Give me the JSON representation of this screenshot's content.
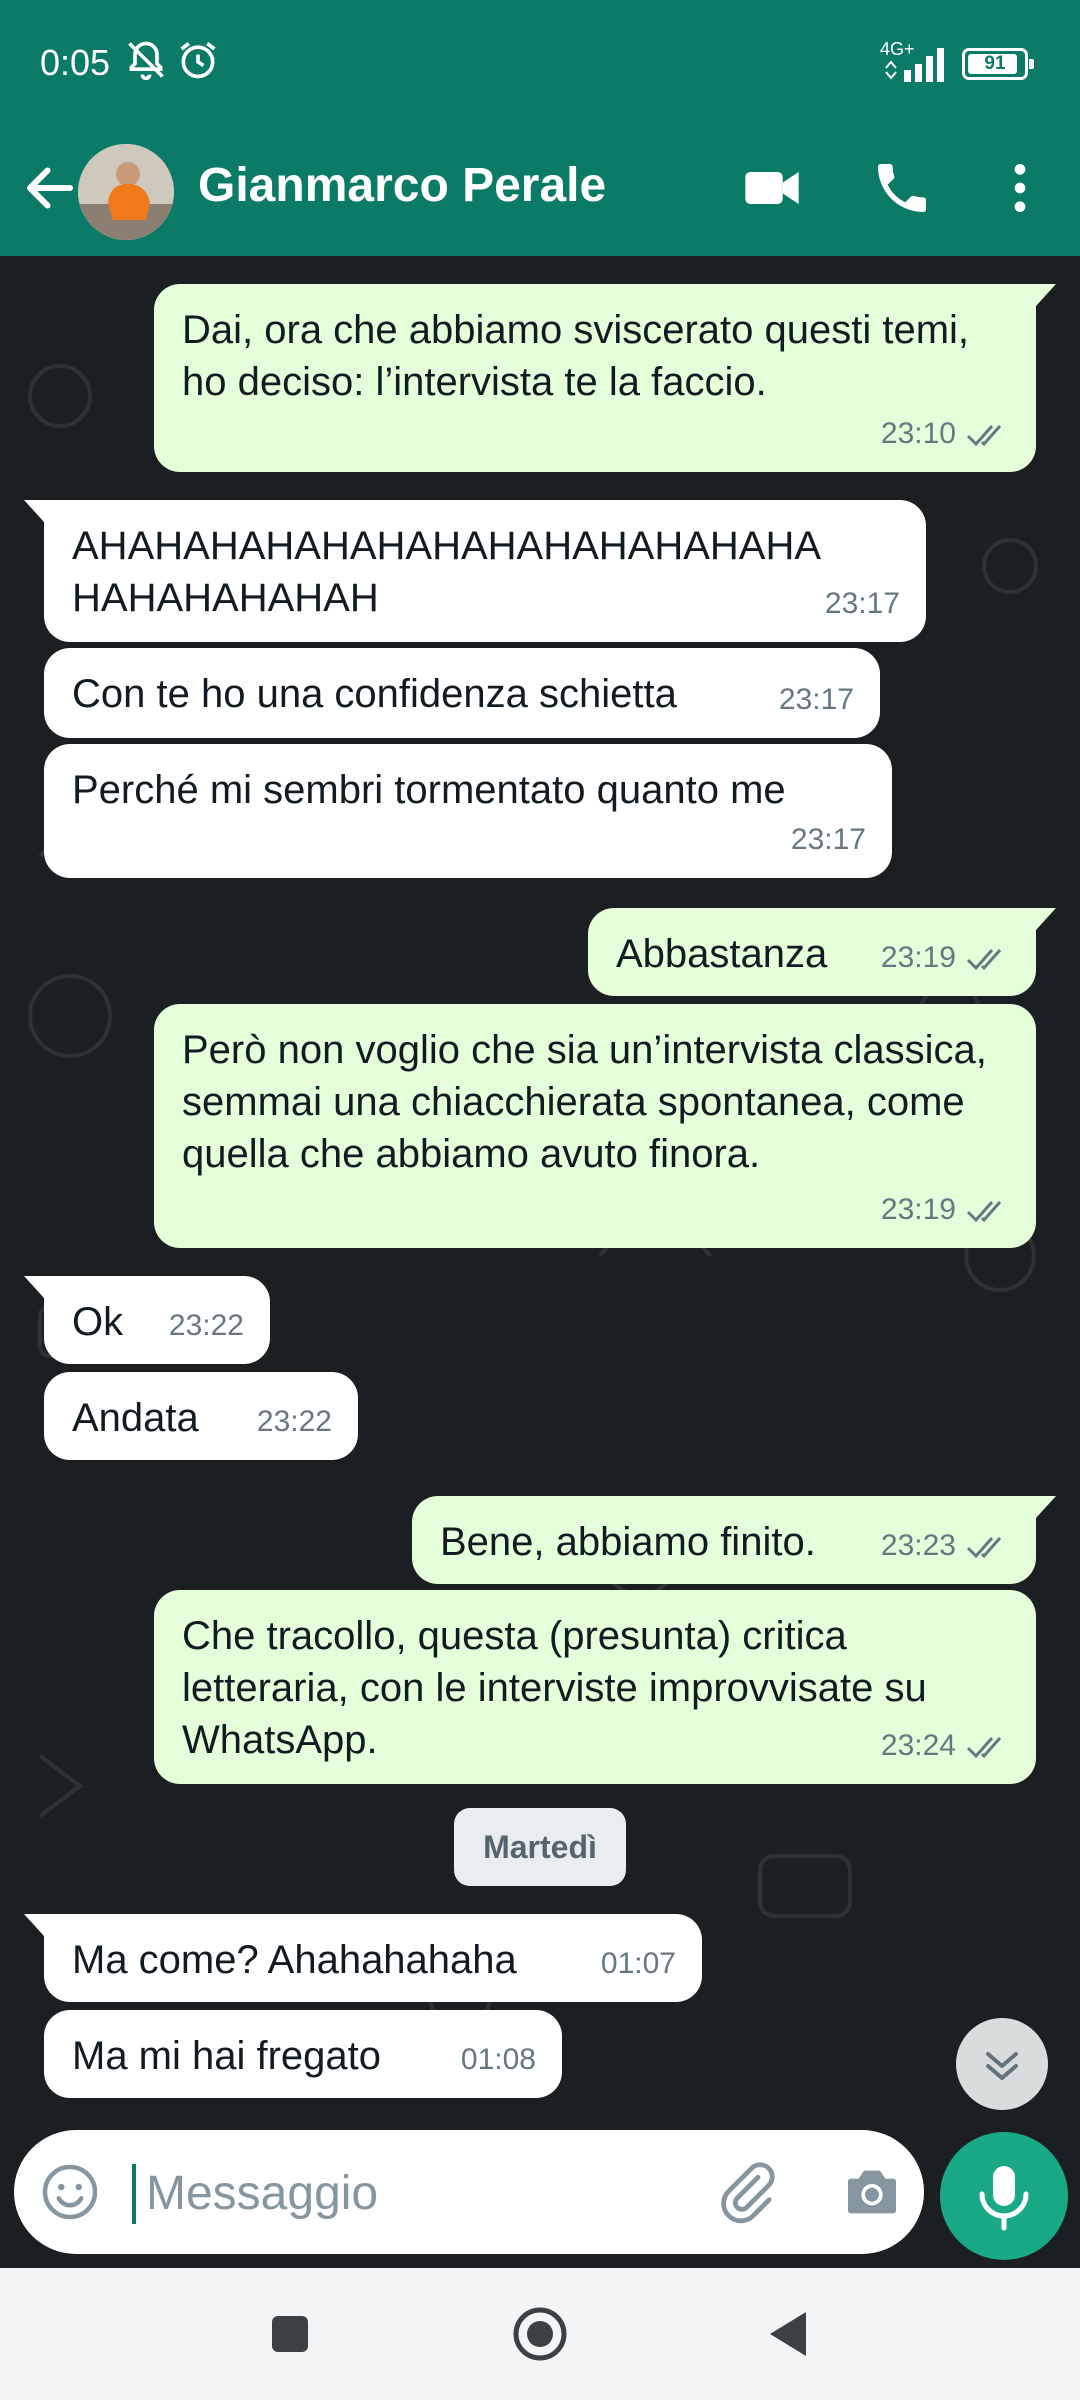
{
  "status_bar": {
    "time": "0:05",
    "network": "4G+",
    "battery": "91",
    "battery_level": 0.91
  },
  "header": {
    "contact_name": "Gianmarco Perale"
  },
  "messages": [
    {
      "dir": "out",
      "text": "Dai, ora che abbiamo sviscerato questi temi, ho deciso: l’intervista te la faccio.",
      "time": "23:10",
      "read": true
    },
    {
      "dir": "in",
      "text": "AHAHAHAHAHAHAHAHAHAHAHAHAHA HAHAHAHAHAH",
      "time": "23:17"
    },
    {
      "dir": "in",
      "text": "Con te ho una confidenza schietta",
      "time": "23:17"
    },
    {
      "dir": "in",
      "text": "Perché mi sembri tormentato quanto me",
      "time": "23:17"
    },
    {
      "dir": "out",
      "text": "Abbastanza",
      "time": "23:19",
      "read": true
    },
    {
      "dir": "out",
      "text": "Però non voglio che sia un’intervista classica, semmai una chiacchierata spontanea, come quella che abbiamo avuto finora.",
      "time": "23:19",
      "read": true
    },
    {
      "dir": "in",
      "text": "Ok",
      "time": "23:22"
    },
    {
      "dir": "in",
      "text": "Andata",
      "time": "23:22"
    },
    {
      "dir": "out",
      "text": "Bene, abbiamo finito.",
      "time": "23:23",
      "read": true
    },
    {
      "dir": "out",
      "text": "Che tracollo, questa (presunta) critica letteraria, con le interviste improvvisate su WhatsApp.",
      "time": "23:24",
      "read": true
    },
    {
      "dir": "in",
      "text": "Ma come? Ahahahahaha",
      "time": "01:07"
    },
    {
      "dir": "in",
      "text": "Ma mi hai fregato",
      "time": "01:08"
    }
  ],
  "day_separator": "Martedì",
  "composer": {
    "placeholder": "Messaggio"
  },
  "colors": {
    "header": "#0b7a66",
    "outgoing_bubble": "#e6ffdb",
    "incoming_bubble": "#ffffff",
    "chat_background": "#1b1f22",
    "mic_button": "#1aa987",
    "read_ticks": "#667781"
  },
  "icons": [
    "back-arrow-icon",
    "video-call-icon",
    "phone-icon",
    "more-vert-icon",
    "emoji-icon",
    "attach-icon",
    "camera-icon",
    "mic-icon",
    "scroll-down-icon",
    "nav-recents-icon",
    "nav-home-icon",
    "nav-back-icon"
  ]
}
